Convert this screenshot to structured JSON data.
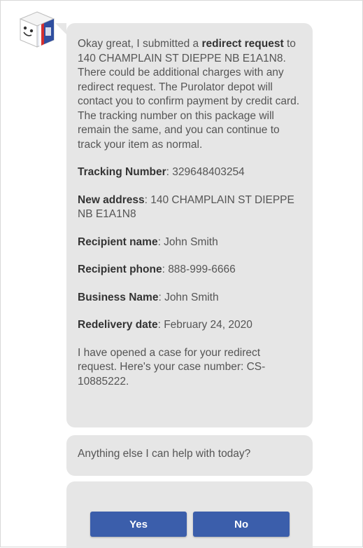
{
  "chat": {
    "message_intro": {
      "p1": "Okay great, I submitted a ",
      "bold": "redirect request",
      "p2": " to 140 CHAMPLAIN ST DIEPPE NB E1A1N8. There could be additional charges with any redirect request. The Purolator depot will contact you to confirm payment by credit card. The tracking number on this package will remain the same, and you can continue to track your item as normal."
    },
    "details": [
      {
        "label": "Tracking Number",
        "value": ": 329648403254"
      },
      {
        "label": "New address",
        "value": ": 140 CHAMPLAIN ST DIEPPE NB E1A1N8"
      },
      {
        "label": "Recipient name",
        "value": ": John Smith"
      },
      {
        "label": "Recipient phone",
        "value": ": 888-999-6666"
      },
      {
        "label": "Business Name",
        "value": ": John Smith"
      },
      {
        "label": "Redelivery date",
        "value": ": February 24, 2020"
      }
    ],
    "case_message": "I have opened a case for your redirect request. Here's your case number: CS-10885222.",
    "followup": "Anything else I can help with today?",
    "yes_label": "Yes",
    "no_label": "No"
  },
  "colors": {
    "bubble_bg": "#e6e6e6",
    "button_bg": "#3b5eab",
    "avatar_red": "#d32f2f",
    "avatar_blue": "#2f4e9f"
  },
  "icons": {
    "avatar": "purolator-box-bot-icon"
  }
}
